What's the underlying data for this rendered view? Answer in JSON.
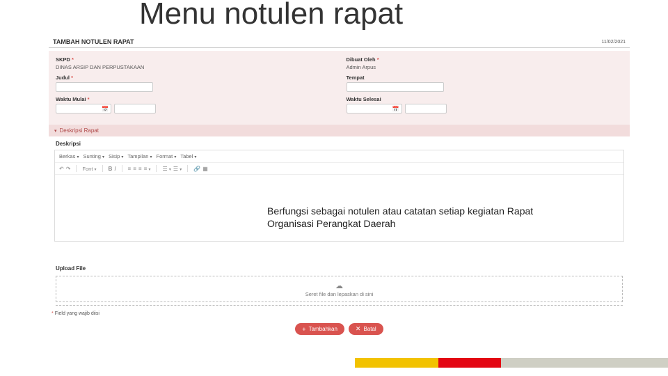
{
  "slide": {
    "title": "Menu notulen rapat",
    "caption": "Berfungsi sebagai notulen atau catatan setiap kegiatan Rapat Organisasi Perangkat Daerah"
  },
  "header": {
    "title": "TAMBAH NOTULEN RAPAT",
    "date": "11/02/2021"
  },
  "form": {
    "skpd_label": "SKPD",
    "skpd_value": "DINAS ARSIP DAN PERPUSTAKAAN",
    "dibuat_label": "Dibuat Oleh",
    "dibuat_value": "Admin Arpus",
    "judul_label": "Judul",
    "tempat_label": "Tempat",
    "mulai_label": "Waktu Mulai",
    "selesai_label": "Waktu Selesai"
  },
  "section": {
    "deskripsi_bar": "Deskripsi Rapat",
    "deskripsi_label": "Deskripsi"
  },
  "editor_menu": {
    "m1": "Berkas",
    "m2": "Sunting",
    "m3": "Sisip",
    "m4": "Tampilan",
    "m5": "Format",
    "m6": "Tabel",
    "font_label": "Font"
  },
  "upload": {
    "label": "Upload File",
    "dropzone_text": "Seret file dan lepaskan di sini"
  },
  "footer": {
    "required_note": "Field yang wajib diisi",
    "btn_add": "Tambahkan",
    "btn_cancel": "Batal"
  }
}
